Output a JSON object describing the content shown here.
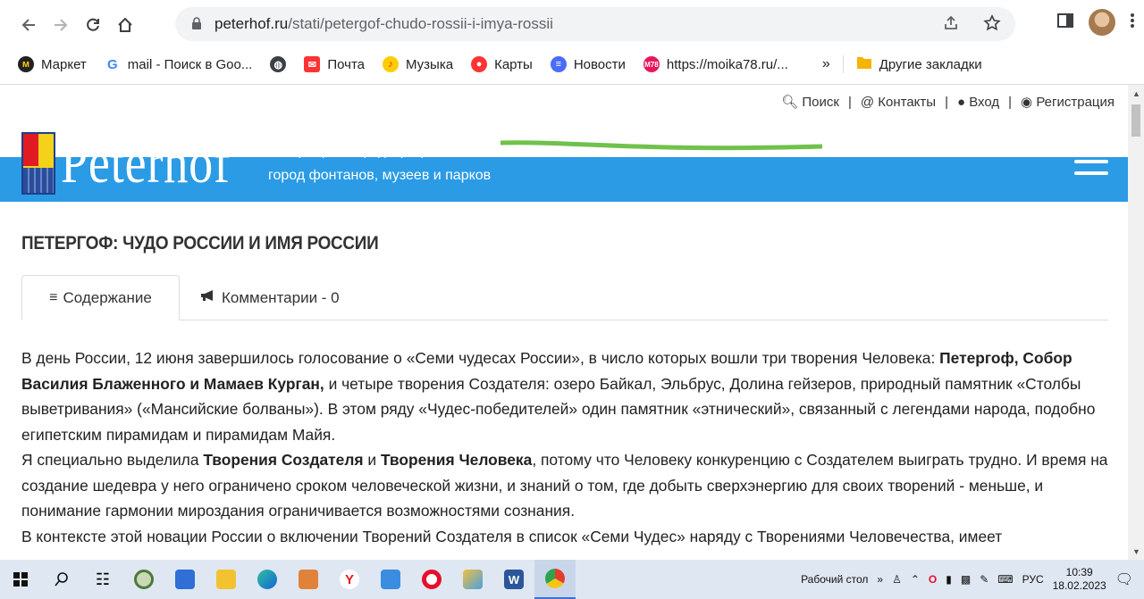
{
  "browser": {
    "url_domain": "peterhof.ru",
    "url_path": "/stati/petergof-chudo-rossii-i-imya-rossii",
    "bookmarks": [
      {
        "label": "Маркет",
        "icon": "market-icon",
        "color": "#ffcc00"
      },
      {
        "label": "mail - Поиск в Goo...",
        "icon": "google-icon",
        "color": "#4285f4"
      },
      {
        "label": "",
        "icon": "globe-icon",
        "color": "#5f6368"
      },
      {
        "label": "Почта",
        "icon": "mail-icon",
        "color": "#ff3333"
      },
      {
        "label": "Музыка",
        "icon": "music-icon",
        "color": "#ffcc00"
      },
      {
        "label": "Карты",
        "icon": "maps-icon",
        "color": "#ff3333"
      },
      {
        "label": "Новости",
        "icon": "news-icon",
        "color": "#4a6cf7"
      },
      {
        "label": "https://moika78.ru/...",
        "icon": "m78-icon",
        "color": "#e8175d"
      }
    ],
    "overflow_label": "»",
    "other_bookmarks": "Другие закладки"
  },
  "site": {
    "top_links": {
      "search": "Поиск",
      "contacts": "Контакты",
      "login": "Вход",
      "register": "Регистрация"
    },
    "logo_text": "Peterhof",
    "tagline1": "Петергоф - Петродворец",
    "tagline2": "город фонтанов, музеев и парков"
  },
  "page": {
    "title": "ПЕТЕРГОФ: ЧУДО РОССИИ И ИМЯ РОССИИ",
    "tabs": [
      {
        "label": "Содержание"
      },
      {
        "label": "Комментарии - 0"
      }
    ],
    "p1_a": "В день России, 12 июня завершилось голосование о «Семи чудесах России», в число которых вошли три творения Человека: ",
    "p1_bold": "Петергоф, Собор Василия Блаженного и Мамаев Курган,",
    "p1_b": " и четыре творения Создателя: озеро Байкал, Эльбрус, Долина гейзеров, природный памятник «Столбы выветривания» («Мансийские болваны»). В этом ряду «Чудес-победителей» один памятник «этнический», связанный с легендами народа, подобно египетским пирамидам и пирамидам Майя.",
    "p2_a": "Я специально выделила ",
    "p2_bold1": "Творения Создателя",
    "p2_b": " и ",
    "p2_bold2": "Творения Человека",
    "p2_c": ", потому что Человеку конкуренцию с Создателем выиграть трудно. И время на создание шедевра у него ограничено сроком человеческой жизни, и знаний о том, где добыть сверхэнергию для своих творений - меньше, и понимание гармонии мироздания ограничивается возможностями сознания.",
    "p3": "В контексте этой новации России о включении Творений Создателя в список «Семи Чудес» наряду с Творениями Человечества, имеет"
  },
  "taskbar": {
    "desktop_label": "Рабочий стол",
    "lang": "РУС",
    "time": "10:39",
    "date": "18.02.2023"
  }
}
